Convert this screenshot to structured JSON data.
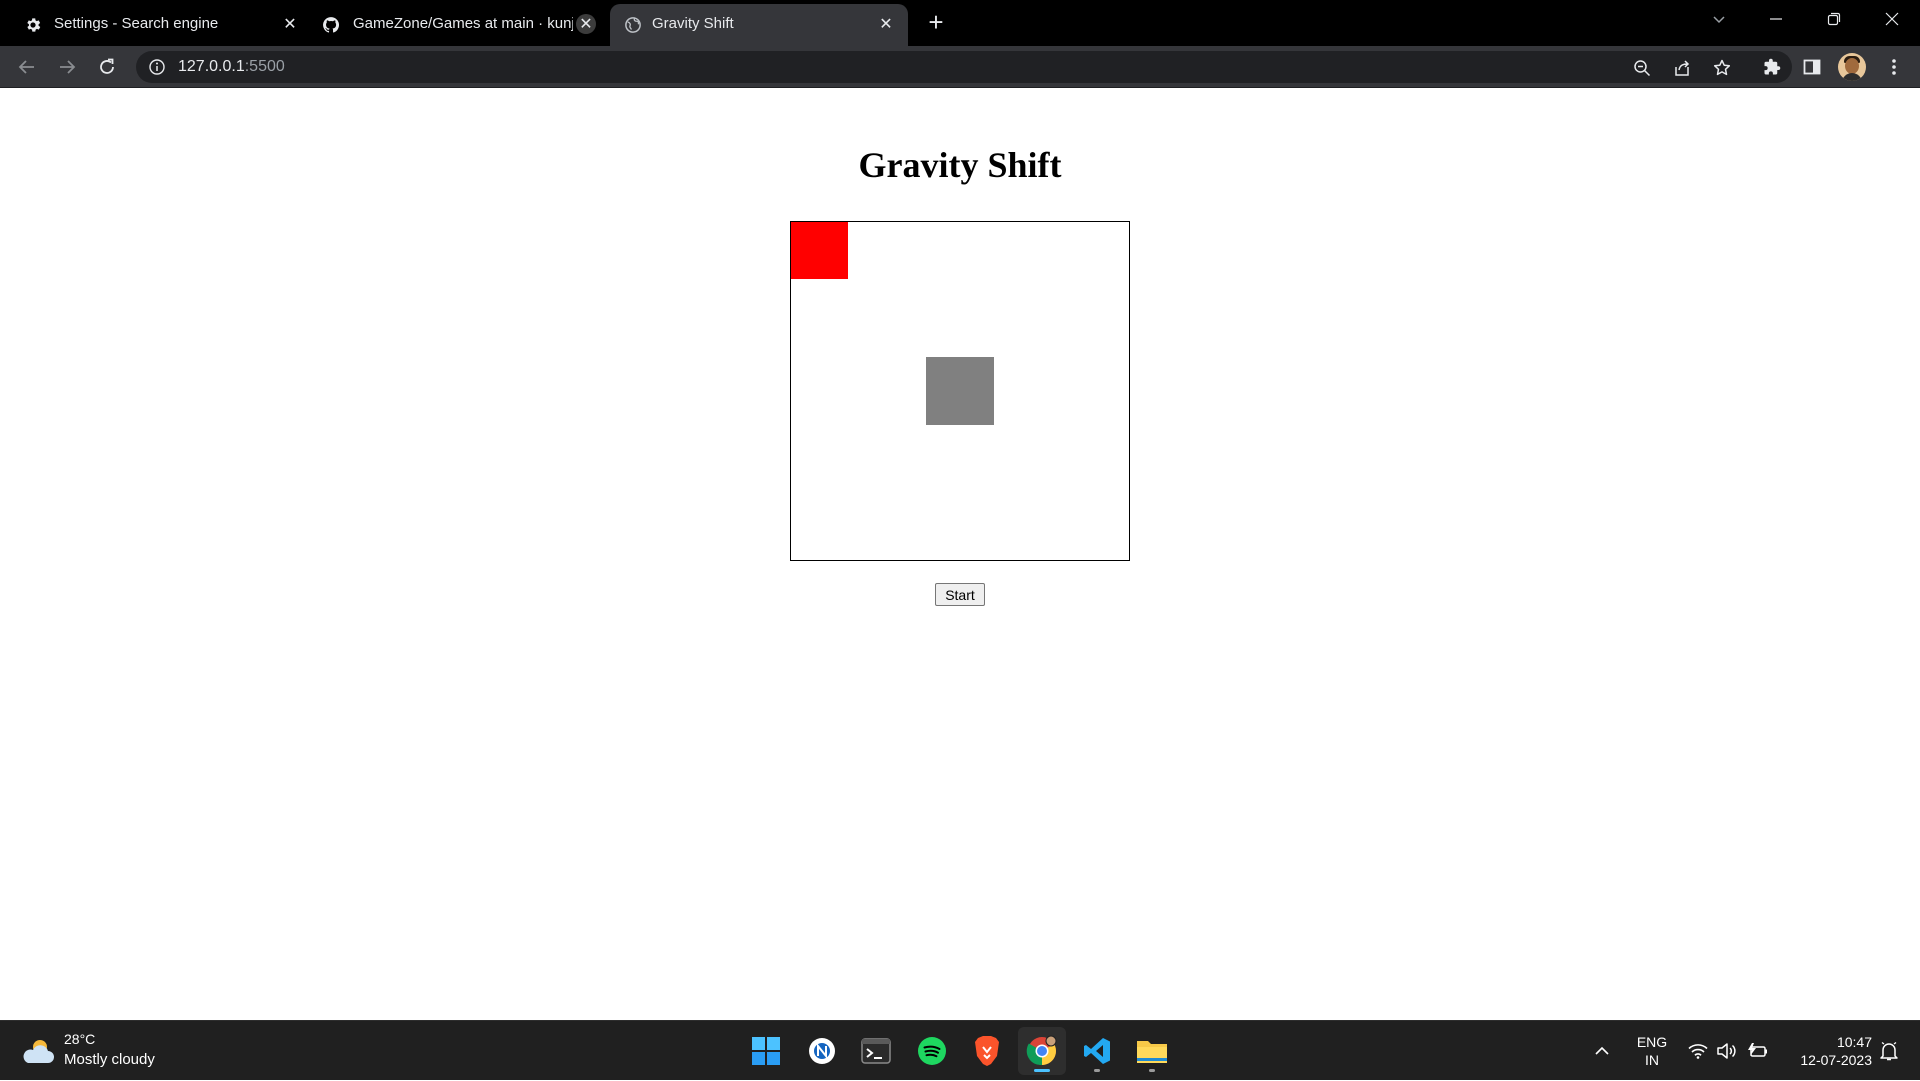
{
  "browser": {
    "tabs": [
      {
        "title": "Settings - Search engine",
        "icon": "gear-icon",
        "active": false
      },
      {
        "title": "GameZone/Games at main · kunj",
        "icon": "github-icon",
        "active": false
      },
      {
        "title": "Gravity Shift",
        "icon": "globe-icon",
        "active": true
      }
    ],
    "address": {
      "host": "127.0.0.1",
      "port": ":5500"
    },
    "colors": {
      "tabstrip": "#000000",
      "toolbar": "#35363a",
      "omnibox": "#202124"
    }
  },
  "page": {
    "title": "Gravity Shift",
    "start_label": "Start",
    "colors": {
      "player": "#ff0000",
      "obstacle": "#808080",
      "border": "#000000"
    }
  },
  "taskbar": {
    "weather": {
      "temp": "28°C",
      "condition": "Mostly cloudy"
    },
    "apps": [
      "windows-start-icon",
      "app-circle-icon",
      "terminal-icon",
      "spotify-icon",
      "brave-icon",
      "chrome-icon",
      "vscode-icon",
      "file-explorer-icon"
    ],
    "language": {
      "line1": "ENG",
      "line2": "IN"
    },
    "time": "10:47",
    "date": "12-07-2023"
  }
}
